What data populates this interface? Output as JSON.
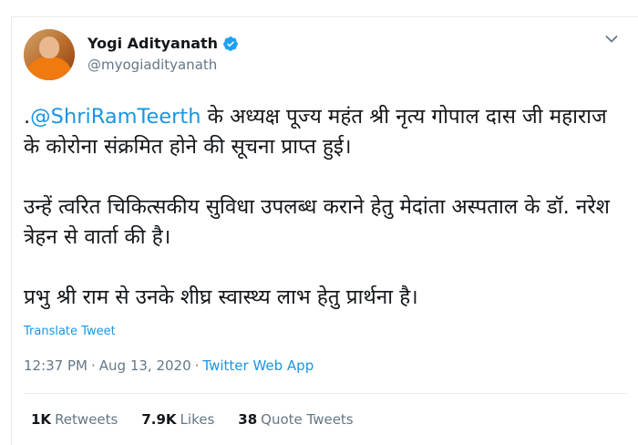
{
  "author": {
    "name": "Yogi Adityanath",
    "handle": "@myogiadityanath"
  },
  "tweet": {
    "prefix": ".",
    "mention": "@ShriRamTeerth",
    "para1_rest": " के अध्यक्ष पूज्य महंत श्री नृत्य गोपाल दास जी महाराज के कोरोना संक्रमित होने की सूचना प्राप्त हुई।",
    "para2": "उन्हें त्वरित चिकित्सकीय सुविधा उपलब्ध कराने हेतु मेदांता अस्पताल के डॉ. नरेश त्रेहन से वार्ता की है।",
    "para3": "प्रभु श्री राम से उनके शीघ्र स्वास्थ्य लाभ हेतु प्रार्थना है।",
    "translate_label": "Translate Tweet"
  },
  "meta": {
    "time": "12:37 PM",
    "separator1": "·",
    "date": "Aug 13, 2020",
    "separator2": "·",
    "source": "Twitter Web App"
  },
  "stats": {
    "retweets_count": "1K",
    "retweets_label": "Retweets",
    "likes_count": "7.9K",
    "likes_label": "Likes",
    "quotes_count": "38",
    "quotes_label": "Quote Tweets"
  },
  "icons": {
    "verified": "verified-badge-icon",
    "menu": "chevron-down-icon"
  },
  "colors": {
    "link": "#1b95e0",
    "secondary_text": "#657786",
    "primary_text": "#14171a",
    "divider": "#e6ecf0"
  }
}
